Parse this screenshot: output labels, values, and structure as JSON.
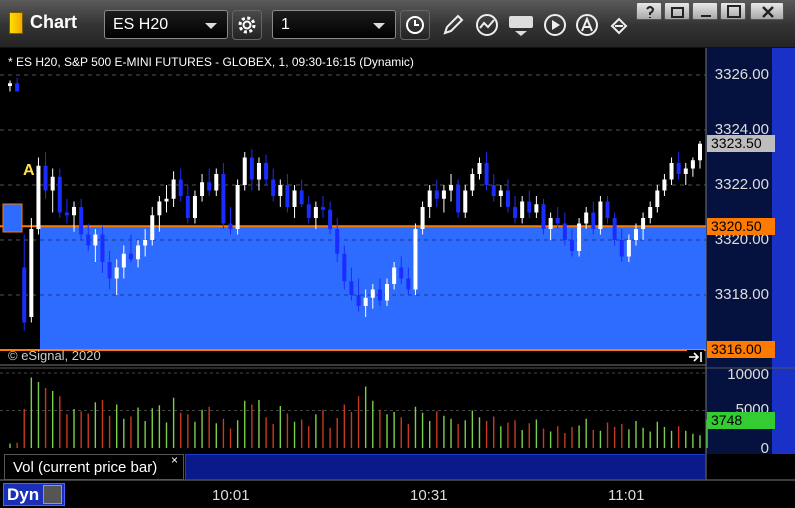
{
  "toolbar": {
    "title": "Chart",
    "symbol": "ES H20",
    "interval": "1"
  },
  "chart": {
    "description": "* ES H20, S&P 500 E-MINI FUTURES - GLOBEX, 1, 09:30-16:15 (Dynamic)",
    "copyright": "© eSignal, 2020",
    "marker_letter": "A",
    "price_axis": [
      "3326.00",
      "3324.00",
      "3322.00",
      "3320.00",
      "3318.00"
    ],
    "current_price": "3323.50",
    "level_high": "3320.50",
    "level_low": "3316.00",
    "colors": {
      "up": "#ffffff",
      "down": "#1a2cff",
      "zone": "#2d6cff",
      "level": "#ff7a00",
      "vol_up": "#7ccf4a",
      "vol_down": "#c83a1e",
      "vol_current": "#33cc33"
    },
    "bars": [
      [
        3325.6,
        3325.8,
        3325.4,
        3325.7
      ],
      [
        3325.7,
        3325.9,
        3325.4,
        3325.4
      ],
      [
        3319.0,
        3320.2,
        3316.7,
        3317.0
      ],
      [
        3317.2,
        3320.8,
        3317.0,
        3320.4
      ],
      [
        3320.4,
        3323.0,
        3320.2,
        3322.7
      ],
      [
        3322.7,
        3323.2,
        3321.5,
        3321.8
      ],
      [
        3321.8,
        3322.6,
        3321.0,
        3322.3
      ],
      [
        3322.3,
        3322.6,
        3320.8,
        3321.0
      ],
      [
        3321.0,
        3321.5,
        3320.6,
        3320.9
      ],
      [
        3320.9,
        3321.4,
        3320.3,
        3321.2
      ],
      [
        3321.2,
        3321.5,
        3320.0,
        3320.2
      ],
      [
        3320.2,
        3320.6,
        3319.6,
        3319.8
      ],
      [
        3319.8,
        3320.4,
        3319.2,
        3320.2
      ],
      [
        3320.2,
        3320.5,
        3318.8,
        3319.2
      ],
      [
        3319.2,
        3319.6,
        3318.2,
        3318.6
      ],
      [
        3318.6,
        3319.3,
        3318.0,
        3319.0
      ],
      [
        3319.0,
        3319.8,
        3318.6,
        3319.5
      ],
      [
        3319.5,
        3320.2,
        3319.2,
        3319.3
      ],
      [
        3319.3,
        3320.0,
        3319.0,
        3319.8
      ],
      [
        3319.8,
        3320.4,
        3319.4,
        3320.0
      ],
      [
        3320.0,
        3321.2,
        3319.8,
        3320.9
      ],
      [
        3320.9,
        3321.6,
        3320.3,
        3321.4
      ],
      [
        3321.4,
        3322.0,
        3321.0,
        3321.5
      ],
      [
        3321.5,
        3322.5,
        3321.2,
        3322.2
      ],
      [
        3322.2,
        3322.6,
        3321.4,
        3321.6
      ],
      [
        3321.6,
        3322.0,
        3320.6,
        3320.8
      ],
      [
        3320.8,
        3321.8,
        3320.6,
        3321.6
      ],
      [
        3321.6,
        3322.4,
        3321.4,
        3322.1
      ],
      [
        3322.1,
        3322.6,
        3321.6,
        3321.8
      ],
      [
        3321.8,
        3322.6,
        3321.6,
        3322.4
      ],
      [
        3322.4,
        3322.8,
        3320.4,
        3320.6
      ],
      [
        3320.6,
        3321.2,
        3320.2,
        3320.4
      ],
      [
        3320.4,
        3322.2,
        3320.2,
        3322.0
      ],
      [
        3322.0,
        3323.2,
        3321.8,
        3323.0
      ],
      [
        3323.0,
        3323.3,
        3321.8,
        3322.2
      ],
      [
        3322.2,
        3323.0,
        3321.8,
        3322.8
      ],
      [
        3322.8,
        3323.1,
        3322.0,
        3322.2
      ],
      [
        3322.2,
        3322.6,
        3321.4,
        3321.6
      ],
      [
        3321.6,
        3322.2,
        3321.2,
        3322.0
      ],
      [
        3322.0,
        3322.4,
        3321.0,
        3321.2
      ],
      [
        3321.2,
        3322.0,
        3320.8,
        3321.8
      ],
      [
        3321.8,
        3322.2,
        3321.2,
        3321.3
      ],
      [
        3321.3,
        3321.6,
        3320.6,
        3320.8
      ],
      [
        3320.8,
        3321.4,
        3320.4,
        3321.2
      ],
      [
        3321.2,
        3321.6,
        3320.8,
        3321.1
      ],
      [
        3321.1,
        3321.4,
        3320.2,
        3320.4
      ],
      [
        3320.4,
        3320.8,
        3319.2,
        3319.5
      ],
      [
        3319.5,
        3319.8,
        3318.2,
        3318.5
      ],
      [
        3318.5,
        3319.0,
        3317.8,
        3318.0
      ],
      [
        3318.0,
        3318.6,
        3317.4,
        3317.6
      ],
      [
        3317.6,
        3318.2,
        3317.2,
        3317.9
      ],
      [
        3317.9,
        3318.4,
        3317.5,
        3318.2
      ],
      [
        3318.2,
        3318.6,
        3317.6,
        3317.8
      ],
      [
        3317.8,
        3318.6,
        3317.6,
        3318.4
      ],
      [
        3318.4,
        3319.2,
        3318.2,
        3319.0
      ],
      [
        3319.0,
        3319.4,
        3318.4,
        3318.6
      ],
      [
        3318.6,
        3319.0,
        3318.0,
        3318.2
      ],
      [
        3318.2,
        3320.6,
        3318.0,
        3320.4
      ],
      [
        3320.4,
        3321.4,
        3320.2,
        3321.2
      ],
      [
        3321.2,
        3322.0,
        3320.8,
        3321.8
      ],
      [
        3321.8,
        3322.2,
        3321.2,
        3321.5
      ],
      [
        3321.5,
        3322.0,
        3321.0,
        3321.8
      ],
      [
        3321.8,
        3322.4,
        3321.4,
        3322.0
      ],
      [
        3322.0,
        3322.2,
        3320.8,
        3321.0
      ],
      [
        3321.0,
        3322.0,
        3320.8,
        3321.8
      ],
      [
        3321.8,
        3322.6,
        3321.6,
        3322.4
      ],
      [
        3322.4,
        3323.0,
        3322.2,
        3322.8
      ],
      [
        3322.8,
        3323.2,
        3321.8,
        3322.0
      ],
      [
        3322.0,
        3322.4,
        3321.4,
        3321.6
      ],
      [
        3321.6,
        3322.0,
        3321.2,
        3321.8
      ],
      [
        3321.8,
        3322.2,
        3321.0,
        3321.2
      ],
      [
        3321.2,
        3321.6,
        3320.6,
        3320.8
      ],
      [
        3320.8,
        3321.6,
        3320.6,
        3321.4
      ],
      [
        3321.4,
        3321.8,
        3320.8,
        3321.0
      ],
      [
        3321.0,
        3321.6,
        3320.8,
        3321.3
      ],
      [
        3321.3,
        3321.5,
        3320.2,
        3320.4
      ],
      [
        3320.4,
        3321.0,
        3320.0,
        3320.8
      ],
      [
        3320.8,
        3321.2,
        3320.4,
        3320.6
      ],
      [
        3320.6,
        3321.0,
        3319.8,
        3320.0
      ],
      [
        3320.0,
        3320.4,
        3319.4,
        3319.6
      ],
      [
        3319.6,
        3320.8,
        3319.4,
        3320.6
      ],
      [
        3320.6,
        3321.2,
        3320.4,
        3321.0
      ],
      [
        3321.0,
        3321.4,
        3320.2,
        3320.4
      ],
      [
        3320.4,
        3321.6,
        3320.2,
        3321.4
      ],
      [
        3321.4,
        3321.6,
        3320.6,
        3320.8
      ],
      [
        3320.8,
        3321.0,
        3319.8,
        3320.0
      ],
      [
        3320.0,
        3320.4,
        3319.2,
        3319.4
      ],
      [
        3319.4,
        3320.2,
        3319.2,
        3320.0
      ],
      [
        3320.0,
        3320.6,
        3319.8,
        3320.4
      ],
      [
        3320.4,
        3321.0,
        3320.0,
        3320.8
      ],
      [
        3320.8,
        3321.4,
        3320.6,
        3321.2
      ],
      [
        3321.2,
        3322.0,
        3321.0,
        3321.8
      ],
      [
        3321.8,
        3322.4,
        3321.6,
        3322.2
      ],
      [
        3322.2,
        3323.0,
        3322.0,
        3322.8
      ],
      [
        3322.8,
        3323.2,
        3322.2,
        3322.4
      ],
      [
        3322.4,
        3322.8,
        3322.0,
        3322.6
      ],
      [
        3322.6,
        3323.0,
        3322.3,
        3322.9
      ],
      [
        3322.9,
        3323.6,
        3322.6,
        3323.5
      ]
    ],
    "volume_axis": [
      "10000",
      "5000",
      "0"
    ],
    "volume_current": "3748",
    "volume_label": "Vol (current price bar)",
    "volume_close": "×",
    "volumes": [
      600,
      700,
      5200,
      9400,
      8800,
      8000,
      7600,
      6900,
      4500,
      5200,
      4900,
      4600,
      6100,
      6400,
      4300,
      5800,
      3900,
      4200,
      5400,
      3600,
      5300,
      5700,
      3400,
      6700,
      4700,
      4500,
      3500,
      5100,
      5500,
      3300,
      3900,
      2600,
      3700,
      6300,
      5800,
      6400,
      4100,
      3200,
      5600,
      4600,
      3500,
      3800,
      2900,
      4500,
      5100,
      2700,
      4000,
      5800,
      4800,
      6900,
      8200,
      6300,
      5100,
      4500,
      4800,
      4100,
      3200,
      5500,
      4700,
      3600,
      4900,
      4300,
      3900,
      3200,
      3700,
      5000,
      4100,
      3600,
      4200,
      2900,
      3400,
      3700,
      2400,
      3300,
      3800,
      2600,
      2200,
      2900,
      2000,
      2800,
      3000,
      3900,
      2400,
      2300,
      3400,
      2800,
      3200,
      2500,
      3600,
      2700,
      2200,
      3500,
      2800,
      2300,
      2900,
      2300,
      1900,
      1700,
      3748
    ],
    "times": [
      "10:01",
      "10:31",
      "11:01"
    ]
  }
}
